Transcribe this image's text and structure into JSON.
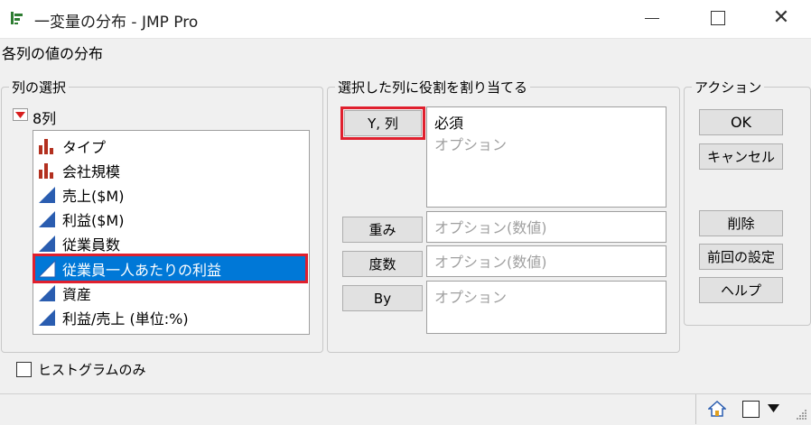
{
  "window": {
    "title": "一変量の分布 - JMP Pro",
    "minimize_glyph": "—",
    "maximize_glyph": "☐",
    "close_glyph": "✕"
  },
  "subtitle": "各列の値の分布",
  "column_select": {
    "legend": "列の選択",
    "count_label": "8列",
    "columns": [
      {
        "label": "タイプ",
        "icon": "nominal-bar-icon"
      },
      {
        "label": "会社規模",
        "icon": "nominal-bar-icon"
      },
      {
        "label": "売上($M)",
        "icon": "continuous-triangle-icon"
      },
      {
        "label": "利益($M)",
        "icon": "continuous-triangle-icon"
      },
      {
        "label": "従業員数",
        "icon": "continuous-triangle-icon"
      },
      {
        "label": "従業員一人あたりの利益",
        "icon": "continuous-triangle-icon",
        "selected": true
      },
      {
        "label": "資産",
        "icon": "continuous-triangle-icon"
      },
      {
        "label": "利益/売上 (単位:%)",
        "icon": "continuous-triangle-icon"
      }
    ]
  },
  "roles": {
    "legend": "選択した列に役割を割り当てる",
    "y_button": "Y, 列",
    "y_required": "必須",
    "y_optional": "オプション",
    "weight_button": "重み",
    "weight_placeholder": "オプション(数値)",
    "freq_button": "度数",
    "freq_placeholder": "オプション(数値)",
    "by_button": "By",
    "by_placeholder": "オプション"
  },
  "actions": {
    "legend": "アクション",
    "ok": "OK",
    "cancel": "キャンセル",
    "remove": "削除",
    "recall": "前回の設定",
    "help": "ヘルプ"
  },
  "options": {
    "histogram_only_label": "ヒストグラムのみ",
    "histogram_only_checked": false
  },
  "colors": {
    "selection": "#0078d7",
    "highlight": "#e0202e",
    "nominal_icon": "#b3301f",
    "continuous_icon": "#2a5db0"
  }
}
